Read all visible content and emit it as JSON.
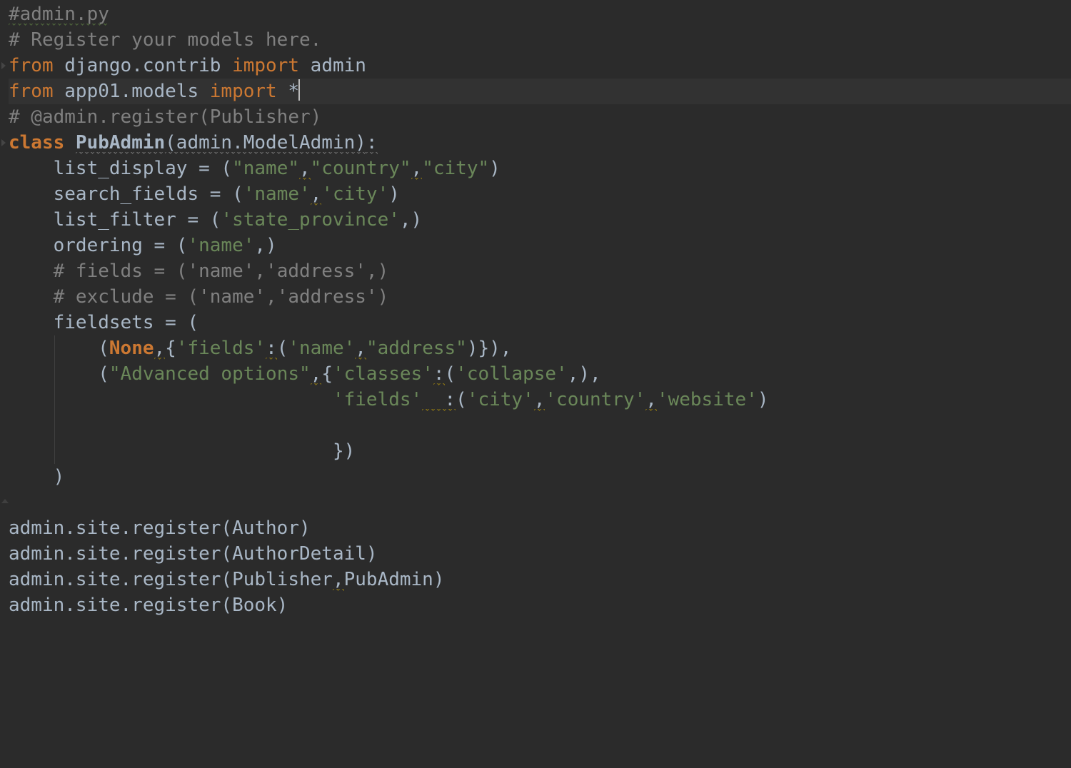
{
  "theme": {
    "background": "#2b2b2b",
    "foreground": "#a9b7c6",
    "keyword": "#cc7832",
    "comment": "#808080",
    "string": "#6a8759",
    "caret": "#bbbbbb",
    "current_line": "#323232"
  },
  "caret": {
    "line_index": 3,
    "after_token": "star"
  },
  "current_line_index": 3,
  "code": {
    "lines": [
      {
        "tokens": [
          {
            "t": "#admin.py",
            "cls": "c typo"
          }
        ]
      },
      {
        "tokens": [
          {
            "t": "# Register your models here.",
            "cls": "c"
          }
        ]
      },
      {
        "fold": "start",
        "tokens": [
          {
            "t": "from ",
            "cls": "kw"
          },
          {
            "t": "django.contrib ",
            "cls": "id"
          },
          {
            "t": "import ",
            "cls": "kw"
          },
          {
            "t": "admin",
            "cls": "id"
          }
        ]
      },
      {
        "current": true,
        "tokens": [
          {
            "t": "from ",
            "cls": "kw"
          },
          {
            "t": "app01.models ",
            "cls": "id"
          },
          {
            "t": "import ",
            "cls": "kw"
          },
          {
            "t": "*",
            "cls": "id",
            "caret_after": true
          }
        ]
      },
      {
        "tokens": [
          {
            "t": "# @admin.register(Publisher)",
            "cls": "c"
          }
        ]
      },
      {
        "fold": "start",
        "tokens": [
          {
            "t": "class ",
            "cls": "kwb"
          },
          {
            "t": "PubAdmin",
            "cls": "cls warn"
          },
          {
            "t": "(admin.ModelAdmin)",
            "cls": "id warn"
          },
          {
            "t": ":",
            "cls": "id warn"
          }
        ]
      },
      {
        "indent": 1,
        "tokens": [
          {
            "t": "list_display = (",
            "cls": "id"
          },
          {
            "t": "\"name\"",
            "cls": "str"
          },
          {
            "t": ",",
            "cls": "id warn-y"
          },
          {
            "t": "\"country\"",
            "cls": "str"
          },
          {
            "t": ",",
            "cls": "id warn-y"
          },
          {
            "t": "\"city\"",
            "cls": "str"
          },
          {
            "t": ")",
            "cls": "id"
          }
        ]
      },
      {
        "indent": 1,
        "tokens": [
          {
            "t": "search_fields = (",
            "cls": "id"
          },
          {
            "t": "'name'",
            "cls": "str"
          },
          {
            "t": ",",
            "cls": "id warn-y"
          },
          {
            "t": "'city'",
            "cls": "str"
          },
          {
            "t": ")",
            "cls": "id"
          }
        ]
      },
      {
        "indent": 1,
        "tokens": [
          {
            "t": "list_filter = (",
            "cls": "id"
          },
          {
            "t": "'state_province'",
            "cls": "str"
          },
          {
            "t": ",)",
            "cls": "id"
          }
        ]
      },
      {
        "indent": 1,
        "tokens": [
          {
            "t": "ordering = (",
            "cls": "id"
          },
          {
            "t": "'name'",
            "cls": "str"
          },
          {
            "t": ",)",
            "cls": "id"
          }
        ]
      },
      {
        "indent": 1,
        "tokens": [
          {
            "t": "# fields = ('name','address',)",
            "cls": "c"
          }
        ]
      },
      {
        "indent": 1,
        "tokens": [
          {
            "t": "# exclude = ('name','address')",
            "cls": "c"
          }
        ]
      },
      {
        "indent": 1,
        "tokens": [
          {
            "t": "fieldsets = (",
            "cls": "id"
          }
        ]
      },
      {
        "indent": 2,
        "guides": [
          1
        ],
        "tokens": [
          {
            "t": "(",
            "cls": "id"
          },
          {
            "t": "None",
            "cls": "bi"
          },
          {
            "t": ",",
            "cls": "id warn-y"
          },
          {
            "t": "{",
            "cls": "id"
          },
          {
            "t": "'fields'",
            "cls": "str"
          },
          {
            "t": ":",
            "cls": "id warn-y"
          },
          {
            "t": "(",
            "cls": "id"
          },
          {
            "t": "'name'",
            "cls": "str"
          },
          {
            "t": ",",
            "cls": "id warn-y"
          },
          {
            "t": "\"address\"",
            "cls": "str"
          },
          {
            "t": ")}),",
            "cls": "id"
          }
        ]
      },
      {
        "indent": 2,
        "guides": [
          1
        ],
        "tokens": [
          {
            "t": "(",
            "cls": "id"
          },
          {
            "t": "\"Advanced options\"",
            "cls": "str"
          },
          {
            "t": ",",
            "cls": "id warn-y"
          },
          {
            "t": "{",
            "cls": "id"
          },
          {
            "t": "'classes'",
            "cls": "str"
          },
          {
            "t": ":",
            "cls": "id warn-y"
          },
          {
            "t": "(",
            "cls": "id"
          },
          {
            "t": "'collapse'",
            "cls": "str"
          },
          {
            "t": ",),",
            "cls": "id"
          }
        ]
      },
      {
        "indent": 0,
        "guides": [
          1
        ],
        "raw_prefix": "                             ",
        "tokens": [
          {
            "t": "'fields'",
            "cls": "str"
          },
          {
            "t": " ",
            "cls": "id warn-y"
          },
          {
            "t": " :",
            "cls": "id warn-y"
          },
          {
            "t": "(",
            "cls": "id"
          },
          {
            "t": "'city'",
            "cls": "str"
          },
          {
            "t": ",",
            "cls": "id warn-y"
          },
          {
            "t": "'country'",
            "cls": "str"
          },
          {
            "t": ",",
            "cls": "id warn-y"
          },
          {
            "t": "'website'",
            "cls": "str"
          },
          {
            "t": ")",
            "cls": "id"
          }
        ]
      },
      {
        "guides": [
          1
        ],
        "tokens": [
          {
            "t": "",
            "cls": "id"
          }
        ]
      },
      {
        "indent": 0,
        "guides": [
          1
        ],
        "raw_prefix": "                             ",
        "tokens": [
          {
            "t": "})",
            "cls": "id"
          }
        ]
      },
      {
        "indent": 1,
        "tokens": [
          {
            "t": ")",
            "cls": "id"
          }
        ]
      },
      {
        "fold": "end",
        "tokens": [
          {
            "t": "",
            "cls": "id"
          }
        ]
      },
      {
        "tokens": [
          {
            "t": "admin.site.register(Author)",
            "cls": "id"
          }
        ]
      },
      {
        "tokens": [
          {
            "t": "admin.site.register(AuthorDetail)",
            "cls": "id"
          }
        ]
      },
      {
        "tokens": [
          {
            "t": "admin.site.register(Publisher",
            "cls": "id"
          },
          {
            "t": ",",
            "cls": "id warn-y"
          },
          {
            "t": "PubAdmin)",
            "cls": "id"
          }
        ]
      },
      {
        "tokens": [
          {
            "t": "admin.site.register(Book)",
            "cls": "id"
          }
        ]
      }
    ]
  }
}
